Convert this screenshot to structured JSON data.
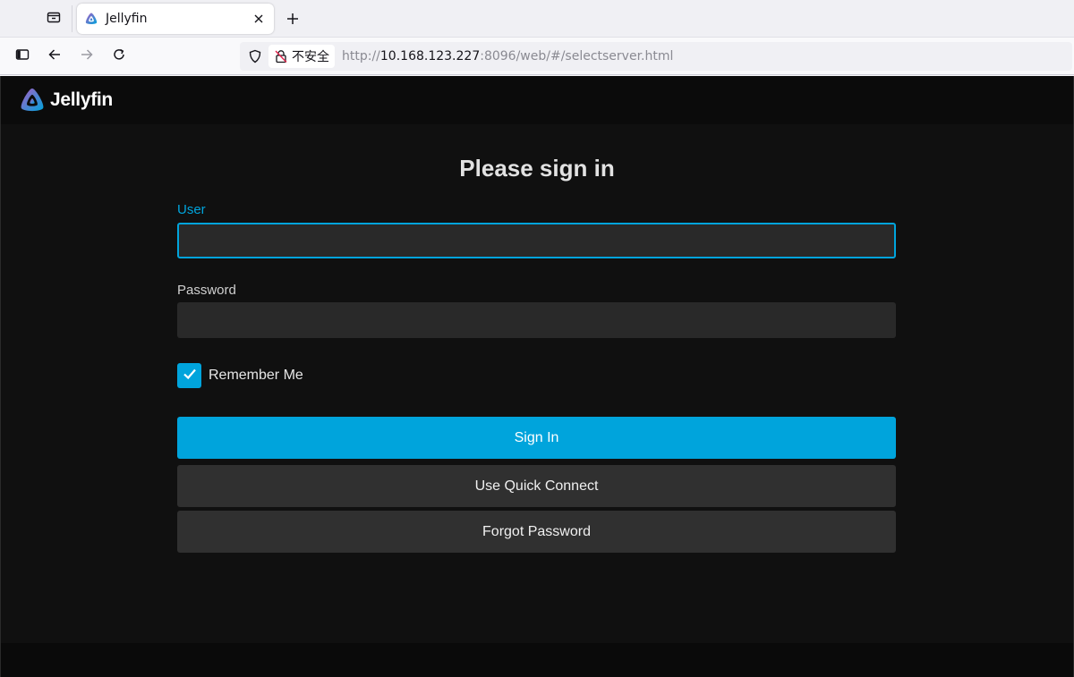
{
  "browser": {
    "tab": {
      "title": "Jellyfin"
    },
    "url_bar": {
      "security_label": "不安全",
      "url_scheme": "http://",
      "url_host": "10.168.123.227",
      "url_rest": ":8096/web/#/selectserver.html"
    }
  },
  "app": {
    "logo_text": "Jellyfin"
  },
  "signin": {
    "title": "Please sign in",
    "user_label": "User",
    "user_value": "",
    "password_label": "Password",
    "password_value": "",
    "remember_me_label": "Remember Me",
    "remember_me_checked": true,
    "sign_in_button": "Sign In",
    "quick_connect_button": "Use Quick Connect",
    "forgot_password_button": "Forgot Password"
  },
  "colors": {
    "accent": "#00a4dc",
    "page_background": "#101010",
    "input_background": "#292929",
    "secondary_button": "#303030"
  }
}
